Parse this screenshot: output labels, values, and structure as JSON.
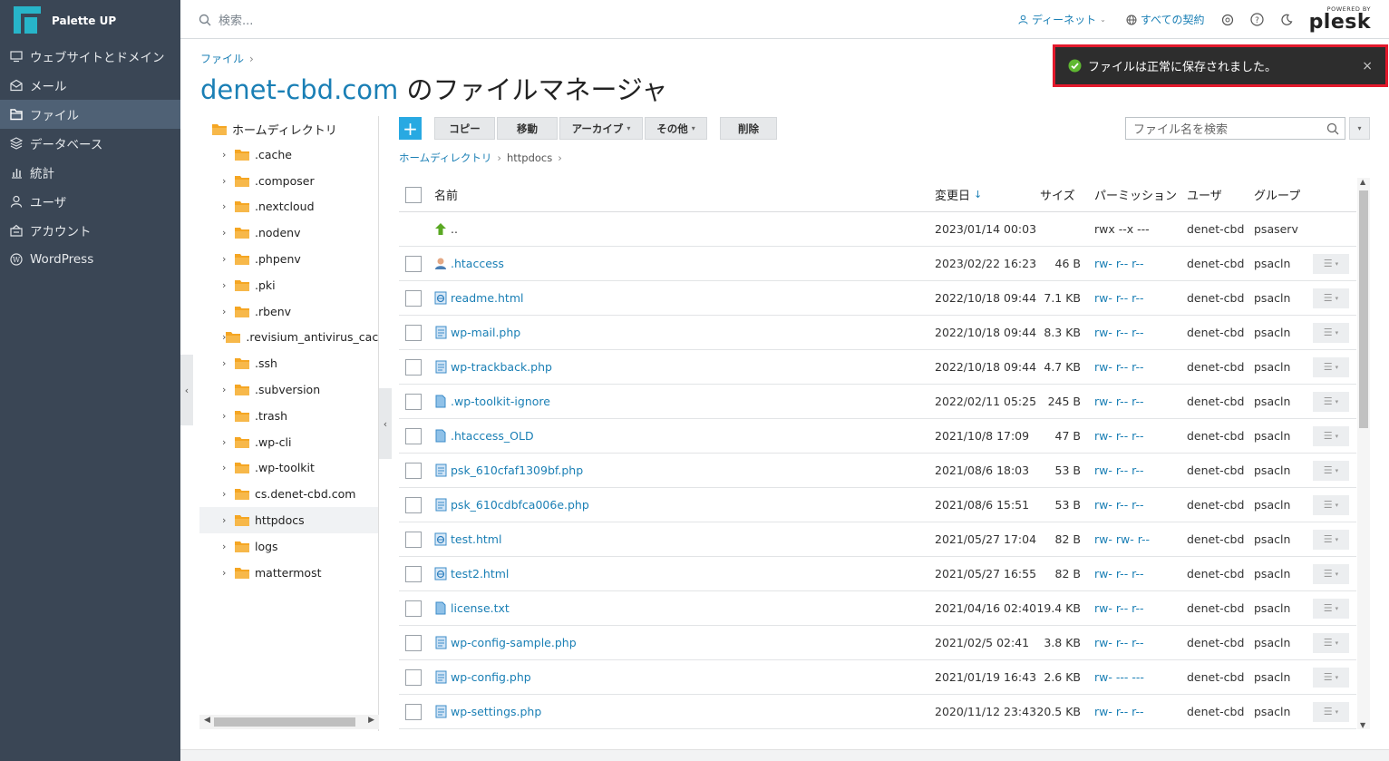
{
  "brand": {
    "name": "Palette UP"
  },
  "sidebar": {
    "items": [
      {
        "label": "ウェブサイトとドメイン",
        "icon": "monitor-icon"
      },
      {
        "label": "メール",
        "icon": "mail-icon"
      },
      {
        "label": "ファイル",
        "icon": "folder-icon",
        "active": true
      },
      {
        "label": "データベース",
        "icon": "database-icon"
      },
      {
        "label": "統計",
        "icon": "chart-icon"
      },
      {
        "label": "ユーザ",
        "icon": "user-icon"
      },
      {
        "label": "アカウント",
        "icon": "account-icon"
      },
      {
        "label": "WordPress",
        "icon": "wordpress-icon"
      }
    ]
  },
  "header": {
    "search_placeholder": "検索...",
    "user_label": "ディーネット",
    "subscriptions_label": "すべての契約",
    "plesk_powered": "POWERED BY",
    "plesk_name": "plesk"
  },
  "toast": {
    "message": "ファイルは正常に保存されました。",
    "close": "×"
  },
  "page": {
    "breadcrumb": "ファイル",
    "title_domain": "denet-cbd.com",
    "title_suffix": " のファイルマネージャ"
  },
  "tree": {
    "root": "ホームディレクトリ",
    "items": [
      ".cache",
      ".composer",
      ".nextcloud",
      ".nodenv",
      ".phpenv",
      ".pki",
      ".rbenv",
      ".revisium_antivirus_cache",
      ".ssh",
      ".subversion",
      ".trash",
      ".wp-cli",
      ".wp-toolkit",
      "cs.denet-cbd.com",
      "httpdocs",
      "logs",
      "mattermost"
    ],
    "selected": "httpdocs"
  },
  "toolbar": {
    "add": "+",
    "copy": "コピー",
    "move": "移動",
    "archive": "アーカイブ",
    "other": "その他",
    "delete": "削除",
    "search_placeholder": "ファイル名を検索"
  },
  "file_breadcrumb": {
    "home": "ホームディレクトリ",
    "current": "httpdocs"
  },
  "table": {
    "headers": {
      "name": "名前",
      "modified": "変更日",
      "size": "サイズ",
      "permissions": "パーミッション",
      "user": "ユーザ",
      "group": "グループ"
    },
    "sort_arrow": "↓",
    "rows": [
      {
        "name": "..",
        "icon": "parent-dir-icon",
        "date": "2023/01/14 00:03",
        "size": "",
        "perm": "rwx --x ---",
        "user": "denet-cbd",
        "group": "psaserv",
        "parent": true
      },
      {
        "name": ".htaccess",
        "icon": "user-file-icon",
        "date": "2023/02/22 16:23",
        "size": "46 B",
        "perm": "rw- r-- r--",
        "user": "denet-cbd",
        "group": "psacln"
      },
      {
        "name": "readme.html",
        "icon": "html-file-icon",
        "date": "2022/10/18 09:44",
        "size": "7.1 KB",
        "perm": "rw- r-- r--",
        "user": "denet-cbd",
        "group": "psacln"
      },
      {
        "name": "wp-mail.php",
        "icon": "php-file-icon",
        "date": "2022/10/18 09:44",
        "size": "8.3 KB",
        "perm": "rw- r-- r--",
        "user": "denet-cbd",
        "group": "psacln"
      },
      {
        "name": "wp-trackback.php",
        "icon": "php-file-icon",
        "date": "2022/10/18 09:44",
        "size": "4.7 KB",
        "perm": "rw- r-- r--",
        "user": "denet-cbd",
        "group": "psacln"
      },
      {
        "name": ".wp-toolkit-ignore",
        "icon": "file-icon",
        "date": "2022/02/11 05:25",
        "size": "245 B",
        "perm": "rw- r-- r--",
        "user": "denet-cbd",
        "group": "psacln"
      },
      {
        "name": ".htaccess_OLD",
        "icon": "file-icon",
        "date": "2021/10/8 17:09",
        "size": "47 B",
        "perm": "rw- r-- r--",
        "user": "denet-cbd",
        "group": "psacln"
      },
      {
        "name": "psk_610cfaf1309bf.php",
        "icon": "php-file-icon",
        "date": "2021/08/6 18:03",
        "size": "53 B",
        "perm": "rw- r-- r--",
        "user": "denet-cbd",
        "group": "psacln"
      },
      {
        "name": "psk_610cdbfca006e.php",
        "icon": "php-file-icon",
        "date": "2021/08/6 15:51",
        "size": "53 B",
        "perm": "rw- r-- r--",
        "user": "denet-cbd",
        "group": "psacln"
      },
      {
        "name": "test.html",
        "icon": "html-file-icon",
        "date": "2021/05/27 17:04",
        "size": "82 B",
        "perm": "rw- rw- r--",
        "user": "denet-cbd",
        "group": "psacln"
      },
      {
        "name": "test2.html",
        "icon": "html-file-icon",
        "date": "2021/05/27 16:55",
        "size": "82 B",
        "perm": "rw- r-- r--",
        "user": "denet-cbd",
        "group": "psacln"
      },
      {
        "name": "license.txt",
        "icon": "file-icon",
        "date": "2021/04/16 02:40",
        "size": "19.4 KB",
        "perm": "rw- r-- r--",
        "user": "denet-cbd",
        "group": "psacln"
      },
      {
        "name": "wp-config-sample.php",
        "icon": "php-file-icon",
        "date": "2021/02/5 02:41",
        "size": "3.8 KB",
        "perm": "rw- r-- r--",
        "user": "denet-cbd",
        "group": "psacln"
      },
      {
        "name": "wp-config.php",
        "icon": "php-file-icon",
        "date": "2021/01/19 16:43",
        "size": "2.6 KB",
        "perm": "rw- --- ---",
        "user": "denet-cbd",
        "group": "psacln"
      },
      {
        "name": "wp-settings.php",
        "icon": "php-file-icon",
        "date": "2020/11/12 23:43",
        "size": "20.5 KB",
        "perm": "rw- r-- r--",
        "user": "denet-cbd",
        "group": "psacln"
      }
    ]
  },
  "colors": {
    "sidebar_bg": "#3a4655",
    "accent": "#1a7fb5",
    "add_button": "#28a9e2",
    "toast_border": "#e3192c",
    "folder": "#f5a623"
  }
}
